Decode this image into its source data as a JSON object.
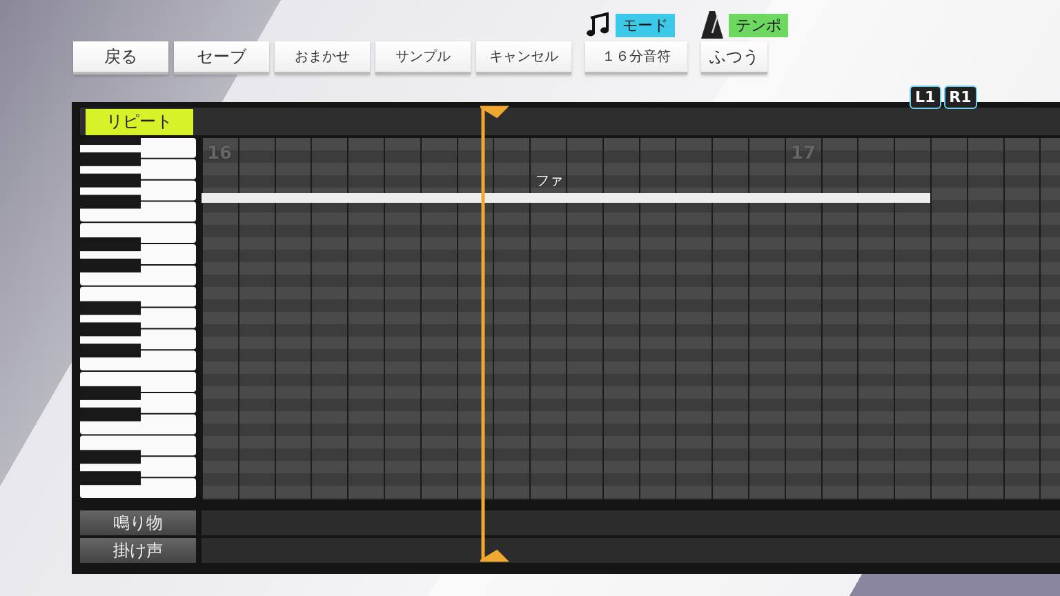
{
  "toolbar": {
    "buttons": [
      "戻る",
      "セーブ",
      "おまかせ",
      "サンプル",
      "キャンセル"
    ]
  },
  "settings": [
    {
      "kind": "note",
      "label": "モード",
      "value": "１６分音符",
      "color": "#3cc8e8"
    },
    {
      "kind": "metronome",
      "label": "テンポ",
      "value": "ふつう",
      "color": "#6cd860"
    }
  ],
  "page_switch": [
    "L1",
    "R1"
  ],
  "editor": {
    "repeat_label": "リピート",
    "measures": [
      "16",
      "17"
    ],
    "notes": [
      {
        "label": "ファ"
      }
    ],
    "tracks": [
      "鳴り物",
      "掛け声"
    ]
  }
}
